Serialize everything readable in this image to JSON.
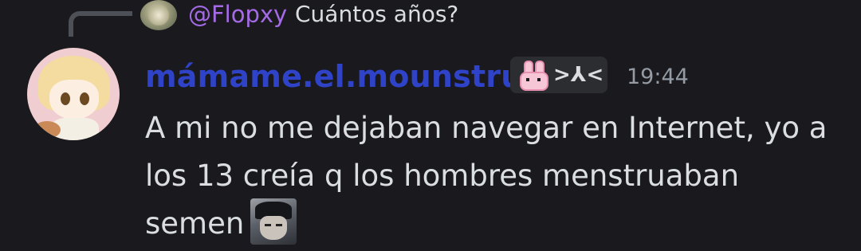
{
  "reply": {
    "author": "@Flopxy",
    "text": "Cuántos años?"
  },
  "message": {
    "author": "mámame.el.mounstruo",
    "tag_icon": "bunny-icon",
    "tag_text": ">⅄<",
    "timestamp": "19:44",
    "lines": [
      "A mi no me dejaban navegar en Internet, yo a",
      "los 13 creía q los hombres menstruaban",
      "semen"
    ],
    "emoji": "custom-emoji-face"
  },
  "colors": {
    "background": "#1a1a1e",
    "username": "#2f43c8",
    "reply_author": "#a56ae6",
    "text": "#dbdee1",
    "timestamp": "#949ba4"
  }
}
